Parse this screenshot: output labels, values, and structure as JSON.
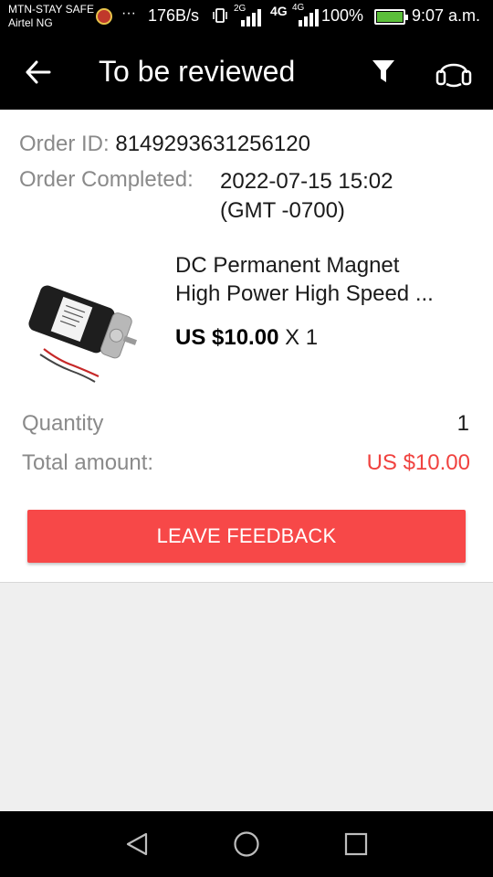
{
  "status_bar": {
    "carrier_1": "MTN-STAY SAFE",
    "carrier_2": "Airtel NG",
    "dots": "···",
    "speed": "176B/s",
    "net_1": "2G",
    "net_2": "4G",
    "net_3": "4G",
    "battery": "100%",
    "time": "9:07 a.m."
  },
  "header": {
    "title": "To be reviewed",
    "icons": [
      "back-arrow-icon",
      "filter-icon",
      "headset-icon"
    ]
  },
  "order": {
    "id_label": "Order ID: ",
    "id_value": "8149293631256120",
    "completed_label": "Order Completed: ",
    "completed_date": "2022-07-15 15:02",
    "completed_tz": "(GMT -0700)"
  },
  "product": {
    "name_line1": "DC Permanent Magnet",
    "name_line2": "High Power High Speed ...",
    "price": "US $10.00",
    "qty": " X 1"
  },
  "summary": {
    "quantity_label": "Quantity",
    "quantity_value": "1",
    "total_label": "Total amount:",
    "total_value": "US $10.00"
  },
  "actions": {
    "feedback_label": "LEAVE FEEDBACK"
  },
  "colors": {
    "accent": "#f74848",
    "price_red": "#f0423f",
    "bar_bg": "#000000",
    "page_bg": "#efefef"
  },
  "nav_bar": {
    "icons": [
      "nav-back-icon",
      "nav-home-icon",
      "nav-recent-icon"
    ]
  }
}
